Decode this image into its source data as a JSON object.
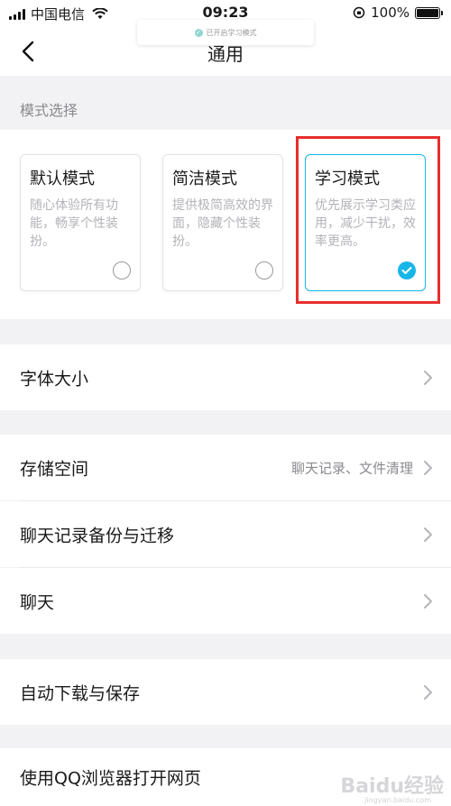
{
  "status_bar": {
    "carrier": "中国电信",
    "time": "09:23",
    "battery": "100%"
  },
  "nav": {
    "title": "通用"
  },
  "toast": {
    "text": "已开启学习模式"
  },
  "mode_section": {
    "label": "模式选择",
    "modes": [
      {
        "title": "默认模式",
        "desc": "随心体验所有功能，畅享个性装扮。",
        "selected": false
      },
      {
        "title": "简洁模式",
        "desc": "提供极简高效的界面，隐藏个性装扮。",
        "selected": false
      },
      {
        "title": "学习模式",
        "desc": "优先展示学习类应用，减少干扰，效率更高。",
        "selected": true
      }
    ]
  },
  "settings": {
    "font_size": {
      "label": "字体大小"
    },
    "storage": {
      "label": "存储空间",
      "value": "聊天记录、文件清理"
    },
    "backup": {
      "label": "聊天记录备份与迁移"
    },
    "chat": {
      "label": "聊天"
    },
    "auto_download": {
      "label": "自动下载与保存"
    },
    "qq_browser": {
      "label": "使用QQ浏览器打开网页"
    }
  },
  "watermark": {
    "brand": "Baidu经验",
    "url": "jingyan.baidu.com"
  },
  "colors": {
    "accent": "#18b6e8",
    "highlight": "#e62e2e",
    "background": "#f2f2f4"
  }
}
